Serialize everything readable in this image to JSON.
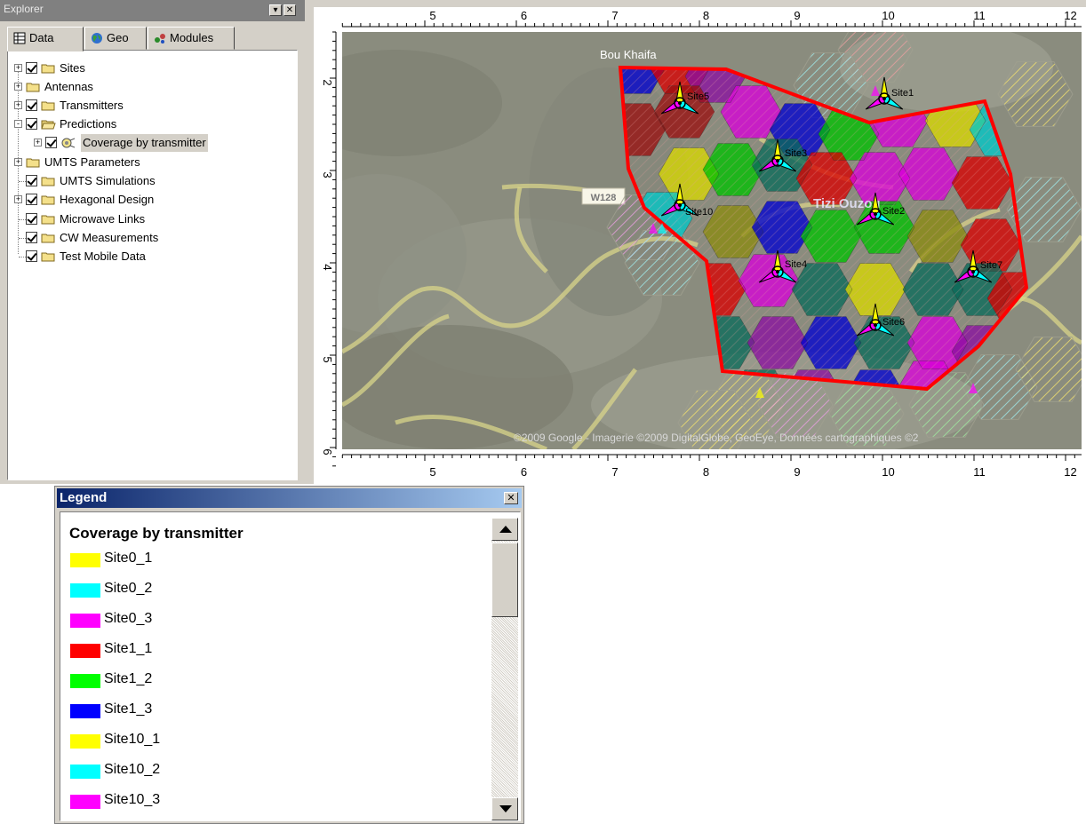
{
  "explorer": {
    "title": "Explorer",
    "tabs": [
      {
        "label": "Data",
        "icon": "table-icon"
      },
      {
        "label": "Geo",
        "icon": "globe-icon"
      },
      {
        "label": "Modules",
        "icon": "modules-icon"
      }
    ],
    "tree": [
      {
        "label": "Sites",
        "checked": true,
        "expander": "+"
      },
      {
        "label": "Antennas",
        "checked": false,
        "expander": "+"
      },
      {
        "label": "Transmitters",
        "checked": true,
        "expander": "+"
      },
      {
        "label": "Predictions",
        "checked": true,
        "expander": "-"
      },
      {
        "label": "Coverage by transmitter",
        "checked": true,
        "expander": "+"
      },
      {
        "label": "UMTS Parameters",
        "checked": false,
        "expander": "+"
      },
      {
        "label": "UMTS Simulations",
        "checked": true,
        "expander": ""
      },
      {
        "label": "Hexagonal Design",
        "checked": true,
        "expander": "+"
      },
      {
        "label": "Microwave Links",
        "checked": true,
        "expander": ""
      },
      {
        "label": "CW Measurements",
        "checked": true,
        "expander": ""
      },
      {
        "label": "Test Mobile Data",
        "checked": true,
        "expander": ""
      }
    ],
    "title_buttons": [
      "▾",
      "✕"
    ]
  },
  "map": {
    "top_ruler": [
      "5",
      "6",
      "7",
      "8",
      "9",
      "10",
      "11",
      "12"
    ],
    "bottom_ruler": [
      "5",
      "6",
      "7",
      "8",
      "9",
      "10",
      "11",
      "12"
    ],
    "left_ruler": [
      "2",
      "3",
      "4",
      "5",
      "6"
    ],
    "place_label": "Bou Khaifa",
    "road_label": "W128",
    "town_label": "Tizi Ouzou",
    "site_labels": [
      "Site5",
      "Site3",
      "Site1",
      "Site10",
      "Site2",
      "Site4",
      "Site7",
      "Site6"
    ],
    "copyright": "©2009 Google - Imagerie ©2009 DigitalGlobe, GeoEye, Données cartographiques ©2"
  },
  "legend": {
    "title": "Legend",
    "close_label": "✕",
    "heading": "Coverage by transmitter",
    "items": [
      {
        "label": "Site0_1",
        "color": "#ffff00"
      },
      {
        "label": "Site0_2",
        "color": "#00ffff"
      },
      {
        "label": "Site0_3",
        "color": "#ff00ff"
      },
      {
        "label": "Site1_1",
        "color": "#ff0000"
      },
      {
        "label": "Site1_2",
        "color": "#00ff00"
      },
      {
        "label": "Site1_3",
        "color": "#0000ff"
      },
      {
        "label": "Site10_1",
        "color": "#ffff00"
      },
      {
        "label": "Site10_2",
        "color": "#00ffff"
      },
      {
        "label": "Site10_3",
        "color": "#ff00ff"
      },
      {
        "label": "",
        "color": "#ff0000"
      }
    ]
  }
}
